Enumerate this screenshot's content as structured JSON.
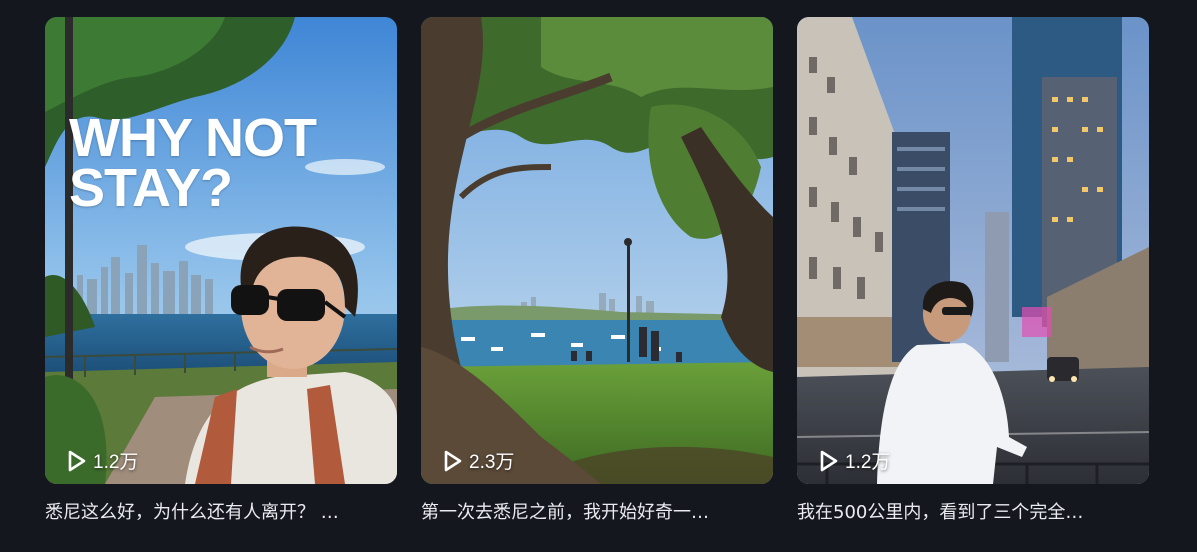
{
  "cards": [
    {
      "overlay_text": "WHY NOT\nSTAY?",
      "plays": "1.2万",
      "title": "悉尼这么好，为什么还有人离开？ …"
    },
    {
      "overlay_text": "",
      "plays": "2.3万",
      "title": "第一次去悉尼之前，我开始好奇一…"
    },
    {
      "overlay_text": "",
      "plays": "1.2万",
      "title": "我在500公里内，看到了三个完全…"
    }
  ],
  "icons": {
    "play": "play-outline-icon"
  },
  "colors": {
    "background": "#15171e",
    "title_text": "#e9ebf0"
  }
}
